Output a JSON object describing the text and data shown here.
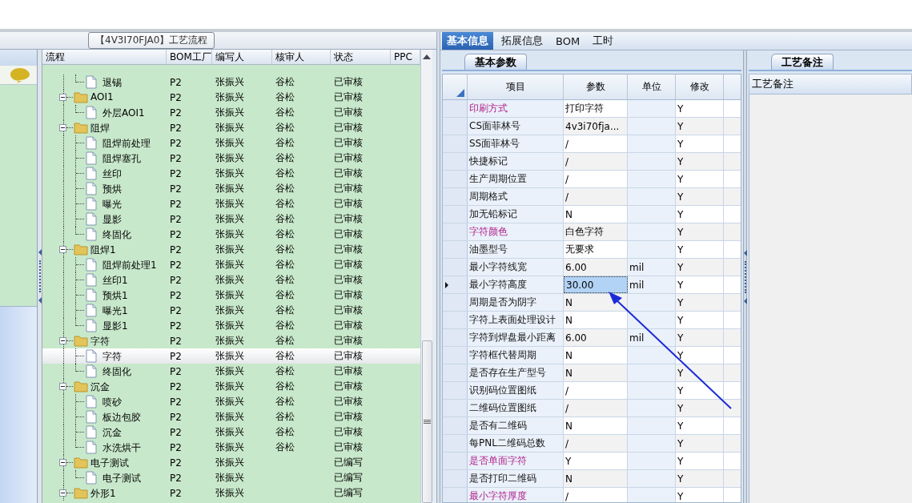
{
  "process_panel": {
    "title_tab": "【4V3I70FJA0】工艺流程",
    "columns": [
      "流程",
      "BOM工厂",
      "编写人",
      "核审人",
      "状态",
      "PPC"
    ],
    "tree": {
      "leading_children": [
        {
          "kind": "leaf",
          "label": "退锡",
          "bom": "P2",
          "writer": "张振兴",
          "reviewer": "谷松",
          "status": "已审核",
          "selected": false
        }
      ],
      "nodes": [
        {
          "kind": "folder",
          "label": "AOI1",
          "bom": "P2",
          "writer": "张振兴",
          "reviewer": "谷松",
          "status": "已审核",
          "expanded": true,
          "selected": false,
          "children": [
            {
              "kind": "leaf",
              "label": "外层AOI1",
              "bom": "P2",
              "writer": "张振兴",
              "reviewer": "谷松",
              "status": "已审核",
              "selected": false
            }
          ]
        },
        {
          "kind": "folder",
          "label": "阻焊",
          "bom": "P2",
          "writer": "张振兴",
          "reviewer": "谷松",
          "status": "已审核",
          "expanded": true,
          "selected": false,
          "children": [
            {
              "kind": "leaf",
              "label": "阻焊前处理",
              "bom": "P2",
              "writer": "张振兴",
              "reviewer": "谷松",
              "status": "已审核",
              "selected": false
            },
            {
              "kind": "leaf",
              "label": "阻焊塞孔",
              "bom": "P2",
              "writer": "张振兴",
              "reviewer": "谷松",
              "status": "已审核",
              "selected": false
            },
            {
              "kind": "leaf",
              "label": "丝印",
              "bom": "P2",
              "writer": "张振兴",
              "reviewer": "谷松",
              "status": "已审核",
              "selected": false
            },
            {
              "kind": "leaf",
              "label": "预烘",
              "bom": "P2",
              "writer": "张振兴",
              "reviewer": "谷松",
              "status": "已审核",
              "selected": false
            },
            {
              "kind": "leaf",
              "label": "曝光",
              "bom": "P2",
              "writer": "张振兴",
              "reviewer": "谷松",
              "status": "已审核",
              "selected": false
            },
            {
              "kind": "leaf",
              "label": "显影",
              "bom": "P2",
              "writer": "张振兴",
              "reviewer": "谷松",
              "status": "已审核",
              "selected": false
            },
            {
              "kind": "leaf",
              "label": "终固化",
              "bom": "P2",
              "writer": "张振兴",
              "reviewer": "谷松",
              "status": "已审核",
              "selected": false
            }
          ]
        },
        {
          "kind": "folder",
          "label": "阻焊1",
          "bom": "P2",
          "writer": "张振兴",
          "reviewer": "谷松",
          "status": "已审核",
          "expanded": true,
          "selected": false,
          "children": [
            {
              "kind": "leaf",
              "label": "阻焊前处理1",
              "bom": "P2",
              "writer": "张振兴",
              "reviewer": "谷松",
              "status": "已审核",
              "selected": false
            },
            {
              "kind": "leaf",
              "label": "丝印1",
              "bom": "P2",
              "writer": "张振兴",
              "reviewer": "谷松",
              "status": "已审核",
              "selected": false
            },
            {
              "kind": "leaf",
              "label": "预烘1",
              "bom": "P2",
              "writer": "张振兴",
              "reviewer": "谷松",
              "status": "已审核",
              "selected": false
            },
            {
              "kind": "leaf",
              "label": "曝光1",
              "bom": "P2",
              "writer": "张振兴",
              "reviewer": "谷松",
              "status": "已审核",
              "selected": false
            },
            {
              "kind": "leaf",
              "label": "显影1",
              "bom": "P2",
              "writer": "张振兴",
              "reviewer": "谷松",
              "status": "已审核",
              "selected": false
            }
          ]
        },
        {
          "kind": "folder",
          "label": "字符",
          "bom": "P2",
          "writer": "张振兴",
          "reviewer": "谷松",
          "status": "已审核",
          "expanded": true,
          "selected": false,
          "children": [
            {
              "kind": "leaf",
              "label": "字符",
              "bom": "P2",
              "writer": "张振兴",
              "reviewer": "谷松",
              "status": "已审核",
              "selected": true
            },
            {
              "kind": "leaf",
              "label": "终固化",
              "bom": "P2",
              "writer": "张振兴",
              "reviewer": "谷松",
              "status": "已审核",
              "selected": false
            }
          ]
        },
        {
          "kind": "folder",
          "label": "沉金",
          "bom": "P2",
          "writer": "张振兴",
          "reviewer": "谷松",
          "status": "已审核",
          "expanded": true,
          "selected": false,
          "children": [
            {
              "kind": "leaf",
              "label": "喷砂",
              "bom": "P2",
              "writer": "张振兴",
              "reviewer": "谷松",
              "status": "已审核",
              "selected": false
            },
            {
              "kind": "leaf",
              "label": "板边包胶",
              "bom": "P2",
              "writer": "张振兴",
              "reviewer": "谷松",
              "status": "已审核",
              "selected": false
            },
            {
              "kind": "leaf",
              "label": "沉金",
              "bom": "P2",
              "writer": "张振兴",
              "reviewer": "谷松",
              "status": "已审核",
              "selected": false
            },
            {
              "kind": "leaf",
              "label": "水洗烘干",
              "bom": "P2",
              "writer": "张振兴",
              "reviewer": "谷松",
              "status": "已审核",
              "selected": false
            }
          ]
        },
        {
          "kind": "folder",
          "label": "电子测试",
          "bom": "P2",
          "writer": "张振兴",
          "status": "已编写",
          "expanded": true,
          "selected": false,
          "children": [
            {
              "kind": "leaf",
              "label": "电子测试",
              "bom": "P2",
              "writer": "张振兴",
              "status": "已编写",
              "selected": false
            }
          ]
        },
        {
          "kind": "folder",
          "label": "外形1",
          "bom": "P2",
          "writer": "张振兴",
          "status": "已编写",
          "expanded": true,
          "selected": false
        }
      ]
    }
  },
  "info_panel": {
    "tabs": [
      {
        "label": "基本信息",
        "selected": true
      },
      {
        "label": "拓展信息",
        "selected": false
      },
      {
        "label": "BOM",
        "selected": false
      },
      {
        "label": "工时",
        "selected": false
      }
    ],
    "params": {
      "tab": "基本参数",
      "columns": [
        "项目",
        "参数",
        "单位",
        "修改"
      ],
      "rows": [
        {
          "item": "印刷方式",
          "value": "打印字符",
          "modify": "Y",
          "highlight": true,
          "selected": false
        },
        {
          "item": "CS面菲林号",
          "value": "4v3i70fja...",
          "modify": "Y",
          "highlight": false,
          "selected": false
        },
        {
          "item": "SS面菲林号",
          "value": "/",
          "modify": "Y",
          "highlight": false,
          "selected": false
        },
        {
          "item": "快捷标记",
          "value": "/",
          "modify": "Y",
          "highlight": false,
          "selected": false
        },
        {
          "item": "生产周期位置",
          "value": "/",
          "modify": "Y",
          "highlight": false,
          "selected": false
        },
        {
          "item": "周期格式",
          "value": "/",
          "modify": "Y",
          "highlight": false,
          "selected": false
        },
        {
          "item": "加无铅标记",
          "value": "N",
          "modify": "Y",
          "highlight": false,
          "selected": false
        },
        {
          "item": "字符颜色",
          "value": "白色字符",
          "modify": "Y",
          "highlight": true,
          "selected": false
        },
        {
          "item": "油墨型号",
          "value": "无要求",
          "modify": "Y",
          "highlight": false,
          "selected": false
        },
        {
          "item": "最小字符线宽",
          "value": "6.00",
          "unit": "mil",
          "modify": "Y",
          "highlight": false,
          "selected": false
        },
        {
          "item": "最小字符高度",
          "value": "30.00",
          "unit": "mil",
          "modify": "Y",
          "highlight": false,
          "selected": true
        },
        {
          "item": "周期是否为阴字",
          "value": "N",
          "modify": "Y",
          "highlight": false,
          "selected": false
        },
        {
          "item": "字符上表面处理设计",
          "value": "N",
          "modify": "Y",
          "highlight": false,
          "selected": false
        },
        {
          "item": "字符到焊盘最小距离",
          "value": "6.00",
          "unit": "mil",
          "modify": "Y",
          "highlight": false,
          "selected": false
        },
        {
          "item": "字符框代替周期",
          "value": "N",
          "modify": "Y",
          "highlight": false,
          "selected": false
        },
        {
          "item": "是否存在生产型号",
          "value": "N",
          "modify": "Y",
          "highlight": false,
          "selected": false
        },
        {
          "item": "识别码位置图纸",
          "value": "/",
          "modify": "Y",
          "highlight": false,
          "selected": false
        },
        {
          "item": "二维码位置图纸",
          "value": "/",
          "modify": "Y",
          "highlight": false,
          "selected": false
        },
        {
          "item": "是否有二维码",
          "value": "N",
          "modify": "Y",
          "highlight": false,
          "selected": false
        },
        {
          "item": "每PNL二维码总数",
          "value": "/",
          "modify": "Y",
          "highlight": false,
          "selected": false
        },
        {
          "item": "是否单面字符",
          "value": "Y",
          "modify": "Y",
          "highlight": true,
          "selected": false
        },
        {
          "item": "是否打印二维码",
          "value": "N",
          "modify": "Y",
          "highlight": false,
          "selected": false
        },
        {
          "item": "最小字符厚度",
          "value": "/",
          "modify": "Y",
          "highlight": true,
          "selected": false
        }
      ]
    }
  },
  "notes_panel": {
    "tab": "工艺备注",
    "column": "工艺备注"
  }
}
